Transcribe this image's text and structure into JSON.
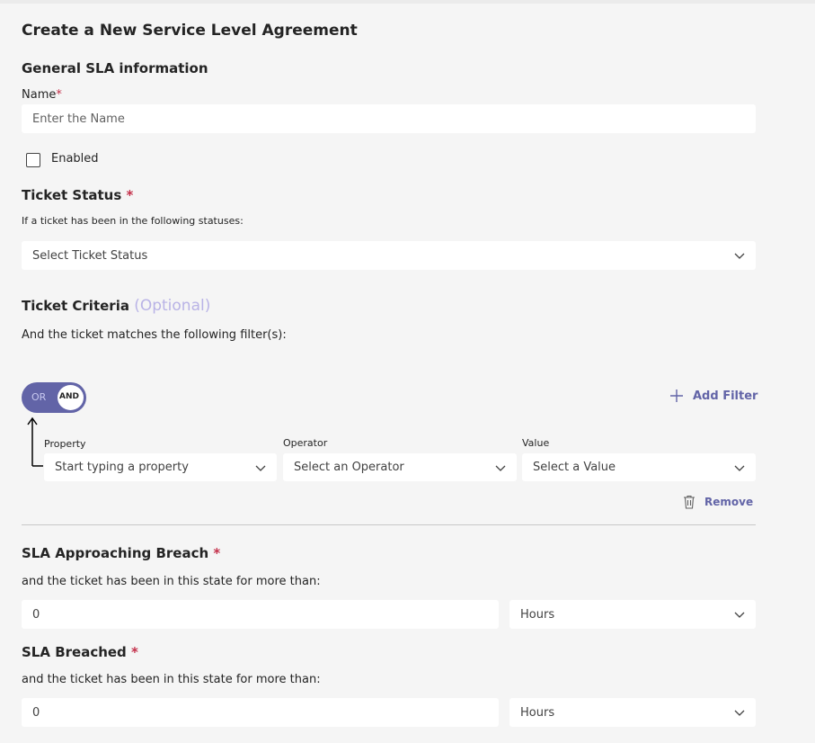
{
  "page": {
    "title": "Create a New Service Level Agreement"
  },
  "general": {
    "heading": "General SLA information",
    "name_label": "Name",
    "required_marker": "*",
    "name_placeholder": "Enter the Name",
    "enabled_label": "Enabled",
    "enabled_checked": false
  },
  "ticket_status": {
    "heading": "Ticket Status",
    "required_marker": "*",
    "description": "If a ticket has been in the following statuses:",
    "select_value": "Select Ticket Status"
  },
  "ticket_criteria": {
    "heading": "Ticket Criteria",
    "optional_label": "(Optional)",
    "description": "And the ticket matches the following filter(s):",
    "toggle": {
      "off_label": "OR",
      "on_label": "AND",
      "selected": "AND"
    },
    "add_filter_label": "Add Filter",
    "filter": {
      "property_label": "Property",
      "property_value": "Start typing a property",
      "operator_label": "Operator",
      "operator_value": "Select an Operator",
      "value_label": "Value",
      "value_value": "Select a Value"
    },
    "remove_label": "Remove"
  },
  "approaching": {
    "heading": "SLA Approaching Breach",
    "required_marker": "*",
    "description": "and the ticket has been in this state for more than:",
    "value": "0",
    "unit": "Hours"
  },
  "breached": {
    "heading": "SLA Breached",
    "required_marker": "*",
    "description": "and the ticket has been in this state for more than:",
    "value": "0",
    "unit": "Hours"
  },
  "colors": {
    "accent": "#6264a7",
    "required": "#c4314b",
    "optional": "#b9b3e6",
    "background": "#f5f5f5"
  }
}
